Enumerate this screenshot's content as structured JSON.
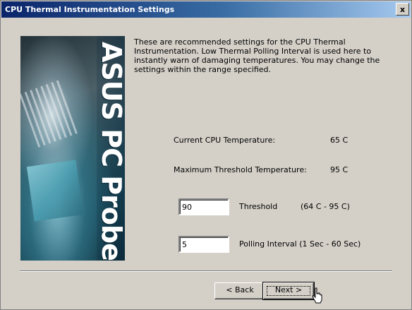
{
  "window": {
    "title": "CPU Thermal Instrumentation Settings",
    "close_label": "x"
  },
  "banner": {
    "brand_text": "ASUS PC Probe"
  },
  "description": "These are recommended settings for the CPU Thermal Instrumentation. Low Thermal Polling Interval is used here to instantly warn of damaging temperatures. You may change the settings within the range specified.",
  "readings": {
    "current_label": "Current CPU Temperature:",
    "current_value": "65 C",
    "max_label": "Maximum Threshold Temperature:",
    "max_value": "95 C"
  },
  "threshold": {
    "value": "90",
    "label": "Threshold",
    "range": "(64 C - 95 C)"
  },
  "polling": {
    "value": "5",
    "label": "Polling Interval (1 Sec - 60 Sec)"
  },
  "buttons": {
    "back": "< Back",
    "next": "Next >"
  },
  "colors": {
    "titlebar_start": "#0a246a",
    "titlebar_end": "#a6caf0",
    "dialog_face": "#d4d0c8"
  }
}
